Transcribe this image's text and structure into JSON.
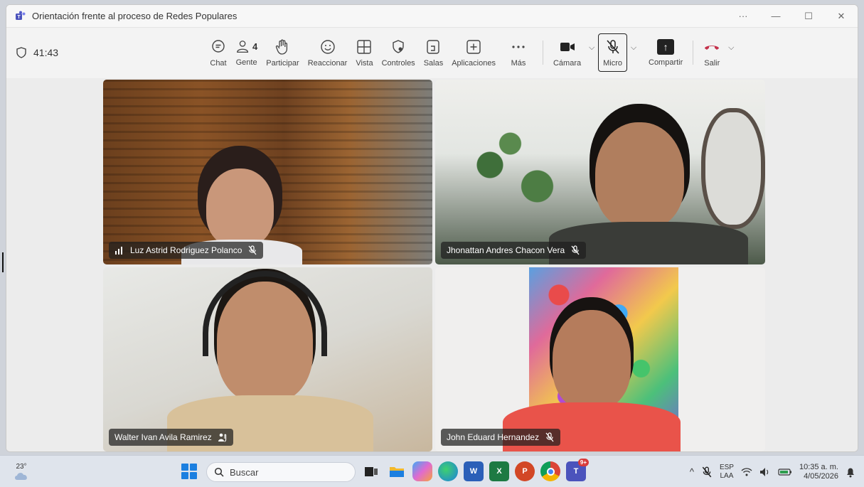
{
  "window": {
    "title": "Orientación frente al proceso de Redes Populares",
    "more_label": "···",
    "minimize_label": "—",
    "maximize_label": "☐",
    "close_label": "✕"
  },
  "toolbar": {
    "timer": "41:43",
    "people_count": "4",
    "buttons": {
      "chat": "Chat",
      "people": "Gente",
      "raise": "Participar",
      "react": "Reaccionar",
      "view": "Vista",
      "controls": "Controles",
      "rooms": "Salas",
      "apps": "Aplicaciones",
      "more": "Más",
      "camera": "Cámara",
      "mic": "Micro",
      "share": "Compartir",
      "leave": "Salir"
    }
  },
  "participants": [
    {
      "name": "Luz Astrid Rodriguez Polanco",
      "status_icon": "mic-off-icon"
    },
    {
      "name": "Jhonattan Andres Chacon Vera",
      "status_icon": "mic-off-icon"
    },
    {
      "name": "Walter Ivan Avila Ramirez",
      "status_icon": "raised-hand-icon"
    },
    {
      "name": "John Eduard Hernandez",
      "status_icon": "mic-off-icon"
    }
  ],
  "taskbar": {
    "weather_temp": "23°",
    "search_placeholder": "Buscar",
    "teams_badge": "9+",
    "lang_1": "ESP",
    "lang_2": "LAA",
    "time": "10:35 a. m.",
    "date": "4/05/2026"
  },
  "colors": {
    "leave_red": "#c4314b",
    "accent_blue": "#1b7fe0"
  }
}
